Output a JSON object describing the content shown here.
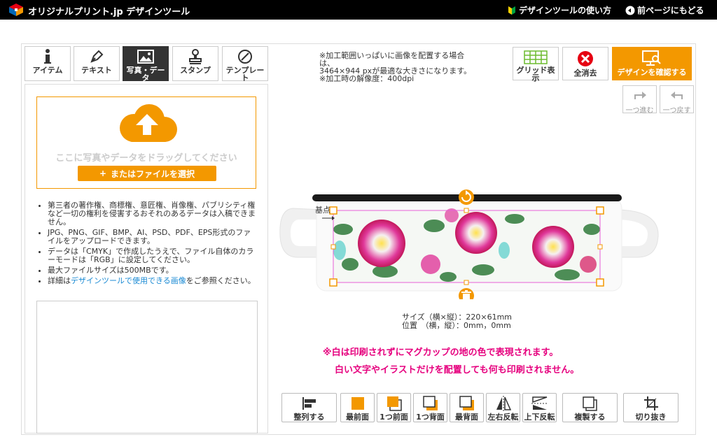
{
  "header": {
    "brand": "オリジナルプリント.jp デザインツール",
    "how_to_label": "デザインツールの使い方",
    "back_label": "前ページにもどる"
  },
  "tabs": [
    {
      "label": "アイテム",
      "icon": "info-icon"
    },
    {
      "label": "テキスト",
      "icon": "pen-icon"
    },
    {
      "label": "写真・データ",
      "icon": "image-icon"
    },
    {
      "label": "スタンプ",
      "icon": "stamp-icon"
    },
    {
      "label": "テンプレート",
      "icon": "compass-icon"
    }
  ],
  "upload": {
    "drop_text": "ここに写真やデータをドラッグしてください",
    "select_label": "またはファイルを選択"
  },
  "notes": [
    "第三者の著作権、商標権、意匠権、肖像権、パブリシティ権など一切の権利を侵害するおそれのあるデータは入稿できません。",
    "JPG、PNG、GIF、BMP、AI、PSD、PDF、EPS形式のファイルをアップロードできます。",
    "データは「CMYK」で作成したうえで、ファイル自体のカラーモードは「RGB」に設定してください。",
    "最大ファイルサイズは500MBです。"
  ],
  "note_link": {
    "prefix": "詳細は",
    "link": "デザインツールで使用できる画像",
    "suffix": "をご参照ください。"
  },
  "info": {
    "line1": "※加工範囲いっぱいに画像を配置する場合は、",
    "line2": "3464×944 pxが最適な大きさになります。",
    "line3": "※加工時の解像度：400dpi"
  },
  "toolbar": {
    "grid_label": "グリッド表示",
    "clear_label": "全消去",
    "confirm_label": "デザインを確認する",
    "redo_label": "一つ進む",
    "undo_label": "一つ戻す"
  },
  "canvas": {
    "origin_label": "基点",
    "size_line": "サイズ（横×縦）：220×61mm",
    "pos_line": "位置　（横，縦）：0mm，0mm"
  },
  "warnings": {
    "line1": "※白は印刷されずにマグカップの地の色で表現されます。",
    "line2": "白い文字やイラストだけを配置しても何も印刷されません。"
  },
  "bottom_tools": [
    {
      "label": "整列する",
      "icon": "align-icon"
    },
    {
      "label": "最前面",
      "icon": "bring-front-icon"
    },
    {
      "label": "1つ前面",
      "icon": "forward-icon"
    },
    {
      "label": "1つ背面",
      "icon": "backward-icon"
    },
    {
      "label": "最背面",
      "icon": "send-back-icon"
    },
    {
      "label": "左右反転",
      "icon": "flip-horizontal-icon"
    },
    {
      "label": "上下反転",
      "icon": "flip-vertical-icon"
    },
    {
      "label": "複製する",
      "icon": "duplicate-icon"
    },
    {
      "label": "切り抜き",
      "icon": "crop-icon"
    }
  ],
  "colors": {
    "accent": "#f39800",
    "warning": "#e6007e",
    "clear_red": "#e60012",
    "link": "#1a8ad4"
  }
}
